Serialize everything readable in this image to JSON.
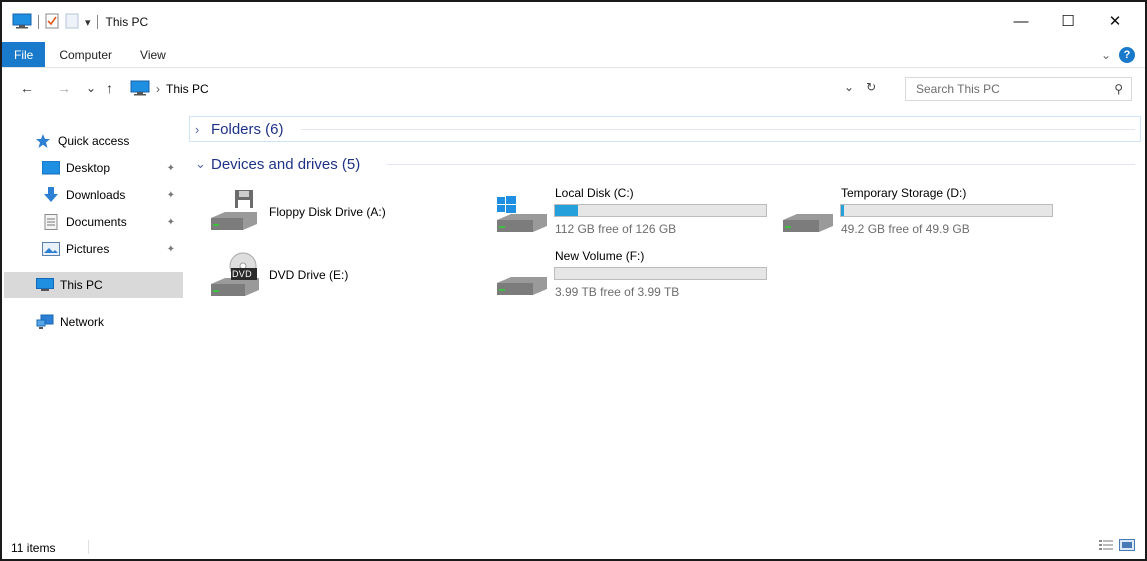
{
  "window": {
    "title": "This PC",
    "controls": {
      "minimize": "—",
      "maximize": "☐",
      "close": "✕"
    }
  },
  "ribbon": {
    "tabs": [
      "File",
      "Computer",
      "View"
    ],
    "expand_glyph": "⌄",
    "help_glyph": "?"
  },
  "address": {
    "back": "←",
    "forward": "→",
    "recent": "⌄",
    "up": "↑",
    "separator": "›",
    "path": "This PC",
    "dropdown": "⌄",
    "refresh": "↻"
  },
  "search": {
    "placeholder": "Search This PC",
    "icon": "⚲"
  },
  "nav": {
    "quick_access": "Quick access",
    "items": [
      {
        "label": "Desktop",
        "pinned": true
      },
      {
        "label": "Downloads",
        "pinned": true
      },
      {
        "label": "Documents",
        "pinned": true
      },
      {
        "label": "Pictures",
        "pinned": true
      }
    ],
    "this_pc": "This PC",
    "network": "Network",
    "pin_glyph": "📌"
  },
  "groups": {
    "folders": {
      "label": "Folders (6)",
      "collapsed_glyph": "›"
    },
    "devices": {
      "label": "Devices and drives (5)",
      "expanded_glyph": "⌄"
    }
  },
  "drives": {
    "floppy": {
      "name": "Floppy Disk Drive (A:)"
    },
    "dvd": {
      "name": "DVD Drive (E:)",
      "badge": "DVD"
    },
    "local_c": {
      "name": "Local Disk (C:)",
      "free": "112 GB free of 126 GB",
      "used_fraction": 0.111
    },
    "temp_d": {
      "name": "Temporary Storage (D:)",
      "free": "49.2 GB free of 49.9 GB",
      "used_fraction": 0.014
    },
    "volume_f": {
      "name": "New Volume (F:)",
      "free": "3.99 TB free of 3.99 TB",
      "used_fraction": 0.0
    }
  },
  "status": {
    "items": "11 items"
  },
  "colors": {
    "accent": "#1979ca",
    "bar_fill": "#26a0da",
    "group_header": "#1e3287"
  }
}
